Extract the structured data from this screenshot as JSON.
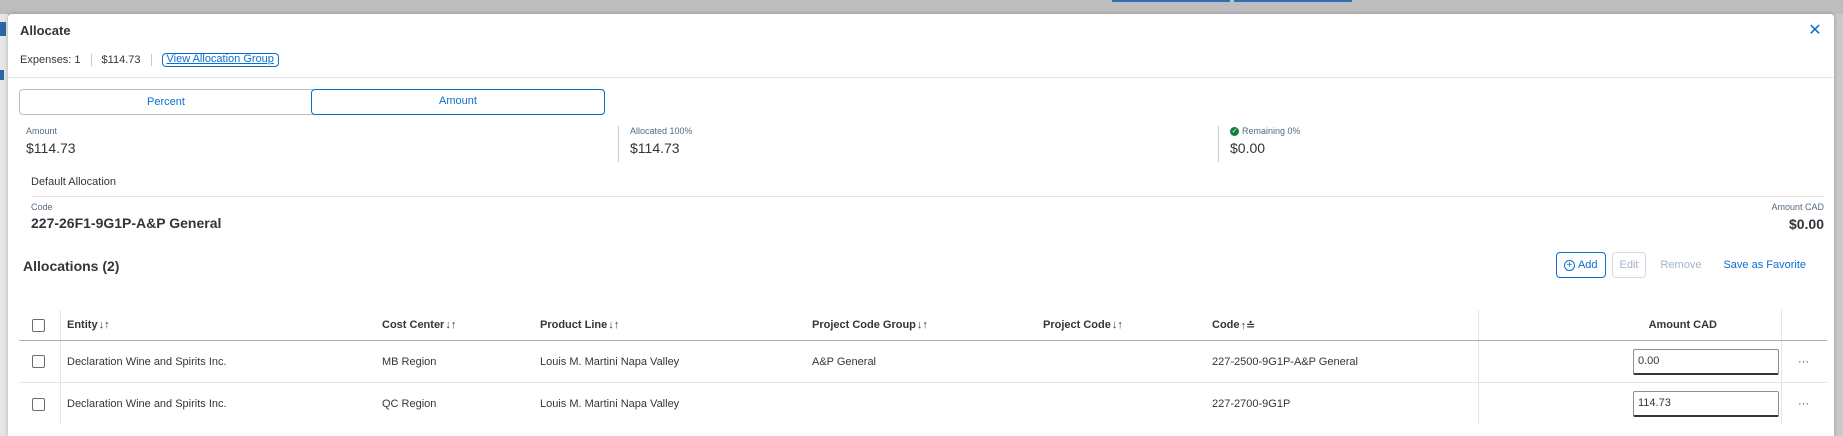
{
  "dialog": {
    "title": "Allocate",
    "close_icon": "close-icon",
    "expenses_text": "Expenses: 1",
    "expenses_amount": "$114.73",
    "view_group_label": "View Allocation Group"
  },
  "mode": {
    "options": [
      "Percent",
      "Amount"
    ],
    "selected": "Amount"
  },
  "summary": {
    "amount_label": "Amount",
    "amount_value": "$114.73",
    "allocated_label": "Allocated 100%",
    "allocated_value": "$114.73",
    "remaining_label": "Remaining 0%",
    "remaining_value": "$0.00",
    "remaining_status_color": "#107e3e"
  },
  "default_allocation": {
    "heading": "Default Allocation",
    "code_label": "Code",
    "code_value": "227-26F1-9G1P-A&P General",
    "amount_label": "Amount CAD",
    "amount_value": "$0.00"
  },
  "allocations": {
    "title": "Allocations (2)",
    "toolbar": {
      "add_label": "Add",
      "edit_label": "Edit",
      "remove_label": "Remove",
      "favorite_label": "Save as Favorite"
    },
    "columns": {
      "entity": "Entity",
      "cost_center": "Cost Center",
      "product_line": "Product Line",
      "project_code_group": "Project Code Group",
      "project_code": "Project Code",
      "code": "Code",
      "amount": "Amount CAD"
    },
    "sort_glyph": "↓↑",
    "code_sort_glyph": "↑≐",
    "rows": [
      {
        "entity": "Declaration Wine and Spirits Inc.",
        "cost_center": "MB Region",
        "product_line": "Louis M. Martini Napa Valley",
        "project_code_group": "A&P General",
        "project_code": "",
        "code": "227-2500-9G1P-A&P General",
        "amount": "0.00",
        "more": "···"
      },
      {
        "entity": "Declaration Wine and Spirits Inc.",
        "cost_center": "QC Region",
        "product_line": "Louis M. Martini Napa Valley",
        "project_code_group": "",
        "project_code": "",
        "code": "227-2700-9G1P",
        "amount": "114.73",
        "more": "···"
      }
    ]
  },
  "colors": {
    "accent": "#0a6ed1",
    "text": "#32363a",
    "disabled": "#a3b3c6"
  }
}
